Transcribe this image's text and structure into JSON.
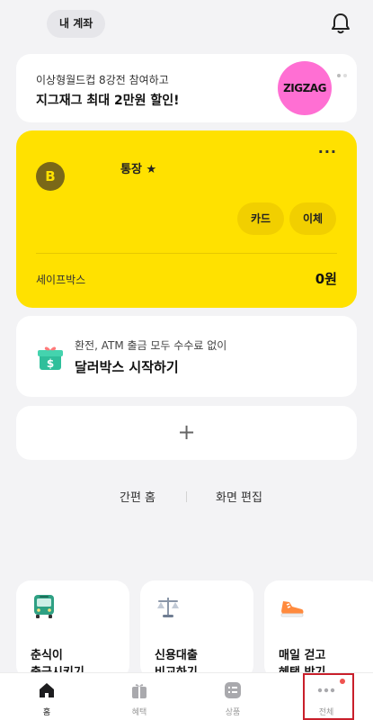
{
  "header": {
    "account_label": "내 계좌"
  },
  "banner": {
    "line1": "이상형월드컵 8강전 참여하고",
    "line2": "지그재그 최대 2만원 할인!",
    "logo_text": "ZIGZAG"
  },
  "account_card": {
    "avatar_letter": "B",
    "name": "통장 ★",
    "more": "···",
    "card_button": "카드",
    "transfer_button": "이체",
    "safebox_label": "세이프박스",
    "safebox_amount": "0원"
  },
  "dollar_box": {
    "line1": "환전, ATM 출금 모두 수수료 없이",
    "line2": "달러박스 시작하기"
  },
  "add_card": {
    "plus": "+"
  },
  "links": {
    "simple_home": "간편 홈",
    "edit_screen": "화면 편집"
  },
  "promos": [
    {
      "line1": "춘식이",
      "line2": "출금시키기",
      "icon": "bus-icon"
    },
    {
      "line1": "신용대출",
      "line2": "비교하기",
      "icon": "scale-icon"
    },
    {
      "line1": "매일 걷고",
      "line2": "혜택 받기",
      "icon": "sneaker-icon"
    }
  ],
  "tabs": [
    {
      "label": "홈",
      "icon": "home-icon",
      "active": true
    },
    {
      "label": "혜택",
      "icon": "gift-icon",
      "active": false
    },
    {
      "label": "상품",
      "icon": "list-icon",
      "active": false
    },
    {
      "label": "전체",
      "icon": "more-icon",
      "active": false
    }
  ],
  "colors": {
    "accent_yellow": "#ffe100",
    "background": "#f3f3f5",
    "highlight_red": "#c91f2b"
  }
}
